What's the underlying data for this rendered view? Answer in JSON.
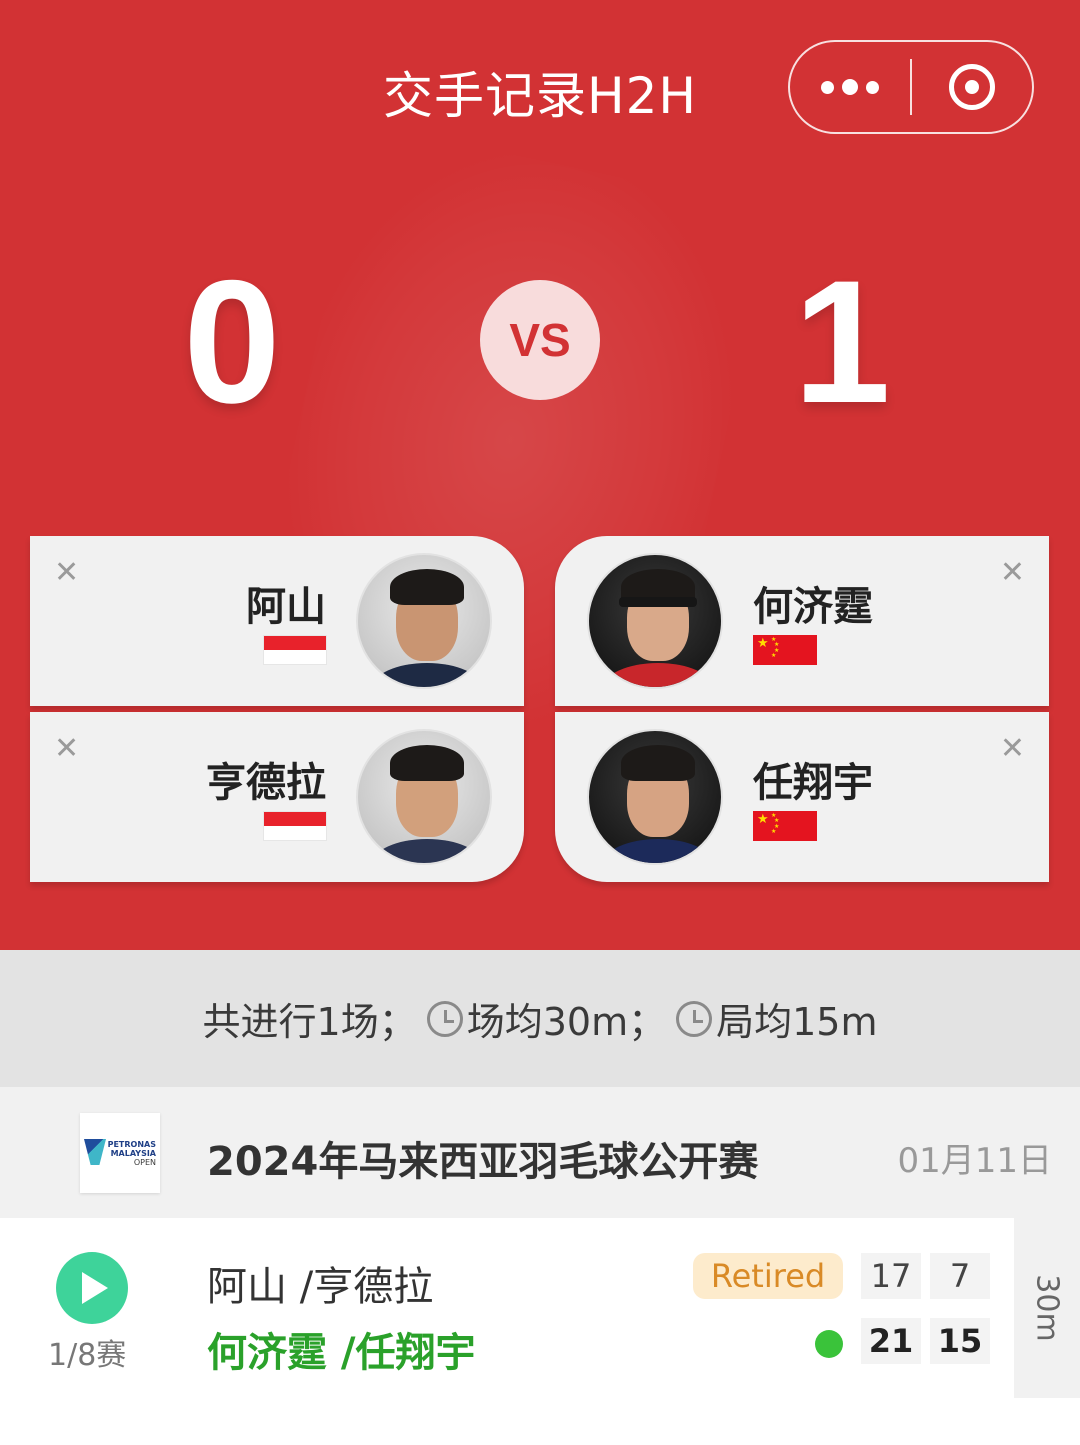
{
  "header": {
    "title": "交手记录H2H",
    "capsule": {
      "more_icon": "more-dots-icon",
      "target_icon": "target-icon"
    }
  },
  "head_to_head": {
    "left_score": "0",
    "vs_label": "VS",
    "right_score": "1"
  },
  "players": {
    "left": [
      {
        "name": "阿山",
        "flag": "indonesia-flag"
      },
      {
        "name": "亨德拉",
        "flag": "indonesia-flag"
      }
    ],
    "right": [
      {
        "name": "何济霆",
        "flag": "china-flag"
      },
      {
        "name": "任翔宇",
        "flag": "china-flag"
      }
    ],
    "remove_icon": "close-icon"
  },
  "summary": {
    "total": "共进行1场；",
    "avg_match": "场均30m；",
    "avg_game": "局均15m"
  },
  "tournament": {
    "logo_lines": [
      "PETRONAS",
      "MALAYSIA",
      "OPEN"
    ],
    "name": "2024年马来西亚羽毛球公开赛",
    "date": "01月11日"
  },
  "match": {
    "round": "1/8赛",
    "team1": "阿山 /亨德拉",
    "team2": "何济霆 /任翔宇",
    "status_badge": "Retired",
    "team1_scores": [
      "17",
      "7"
    ],
    "team2_scores": [
      "21",
      "15"
    ],
    "duration": "30m",
    "colors": {
      "winner": "#2aa12a",
      "play": "#3ed39a",
      "badge_bg": "#fdebcc",
      "badge_text": "#d98a26"
    }
  },
  "colors": {
    "primary": "#d23234",
    "vs_bg": "#f8dcdc"
  }
}
